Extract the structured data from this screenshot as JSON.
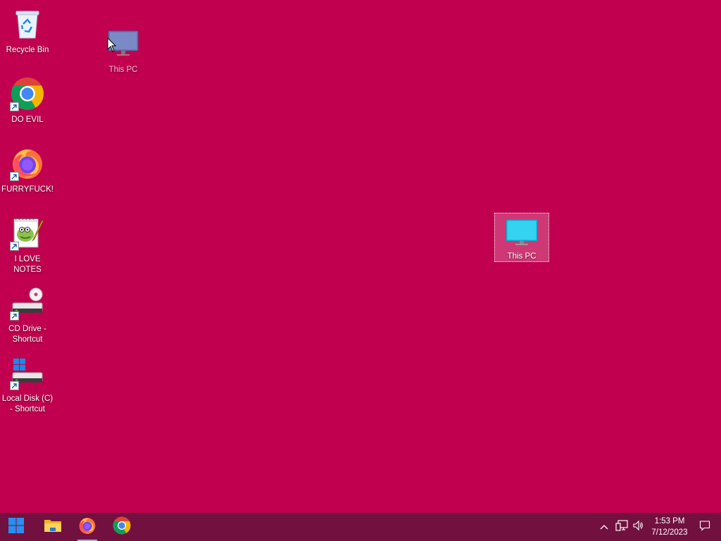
{
  "desktop": {
    "background_color": "#c1004f",
    "icons": [
      {
        "label": "Recycle Bin",
        "icon": "recycle-bin-icon",
        "shortcut": false
      },
      {
        "label": "This PC",
        "icon": "this-pc-icon",
        "shortcut": false,
        "state": "being-dragged"
      },
      {
        "label": "DO EVIL",
        "icon": "chrome-icon",
        "shortcut": true
      },
      {
        "label": "FURRYFUCK!",
        "icon": "firefox-icon",
        "shortcut": true
      },
      {
        "label": "I LOVE NOTES",
        "icon": "notepad-plus-plus-icon",
        "shortcut": true
      },
      {
        "label": "CD Drive - Shortcut",
        "icon": "cd-drive-icon",
        "shortcut": true
      },
      {
        "label": "Local Disk (C) - Shortcut",
        "icon": "local-disk-icon",
        "shortcut": true
      },
      {
        "label": "This PC",
        "icon": "this-pc-icon",
        "shortcut": false,
        "state": "selected"
      }
    ]
  },
  "taskbar": {
    "background_color": "#72103f",
    "pinned": [
      {
        "name": "Start",
        "icon": "windows-start-icon"
      },
      {
        "name": "File Explorer",
        "icon": "file-explorer-icon"
      },
      {
        "name": "Firefox",
        "icon": "firefox-icon",
        "active": true
      },
      {
        "name": "Google Chrome",
        "icon": "chrome-icon"
      }
    ],
    "tray": {
      "icons": [
        "chevron-up-icon",
        "network-icon",
        "volume-icon",
        "notification-icon"
      ],
      "time": "1:53 PM",
      "date": "7/12/2023"
    }
  }
}
